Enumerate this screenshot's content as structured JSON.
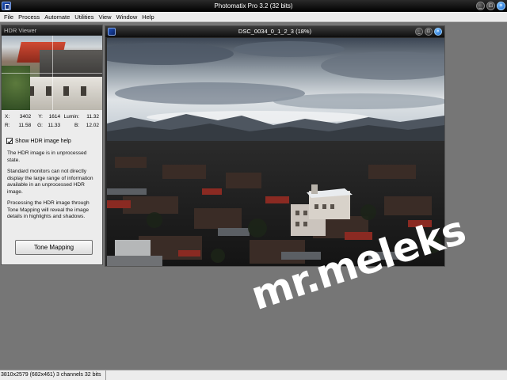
{
  "app": {
    "title": "Photomatix Pro 3.2 (32 bits)",
    "window_buttons": [
      "minimize-icon",
      "maximize-icon",
      "close-icon"
    ]
  },
  "menu": [
    "File",
    "Process",
    "Automate",
    "Utilities",
    "View",
    "Window",
    "Help"
  ],
  "hdr_viewer": {
    "title": "HDR Viewer",
    "readout": {
      "x_label": "X:",
      "x": "3402",
      "y_label": "Y:",
      "y": "1614",
      "lumin_label": "Lumin:",
      "lumin": "11.32",
      "r_label": "R:",
      "r": "11.58",
      "g_label": "G:",
      "g": "11.33",
      "b_label": "B:",
      "b": "12.02"
    },
    "show_help_label": "Show HDR image help",
    "show_help_checked": true,
    "help_paragraphs": [
      "The HDR image is in unprocessed state.",
      "Standard monitors can not directly display the large range of information available in an unprocessed HDR image.",
      "Processing the HDR image through Tone Mapping will reveal the image details in highlights and shadows."
    ],
    "tone_mapping_label": "Tone Mapping"
  },
  "image_window": {
    "title": "DSC_0034_0_1_2_3 (18%)"
  },
  "watermark": "mr.meleks",
  "status": {
    "text": "3810x2579 (682x461) 3 channels 32 bits"
  }
}
